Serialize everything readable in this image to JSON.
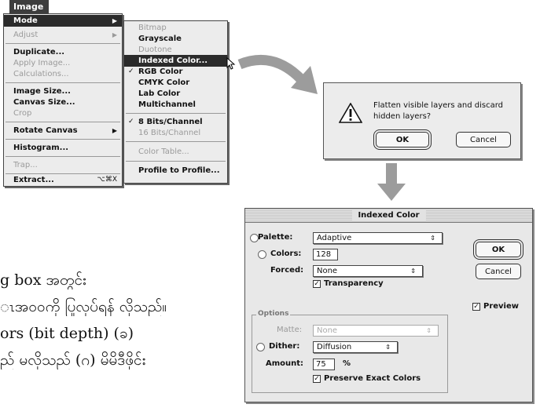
{
  "image_menu": {
    "title": "Image",
    "items": [
      {
        "label": "Mode",
        "arrow": "▶",
        "highlighted": true
      },
      {
        "label": "Adjust",
        "arrow": "▶",
        "disabled": true
      },
      {
        "label": "Duplicate..."
      },
      {
        "label": "Apply Image...",
        "disabled": true
      },
      {
        "label": "Calculations...",
        "disabled": true
      },
      {
        "label": "Image Size..."
      },
      {
        "label": "Canvas Size..."
      },
      {
        "label": "Crop",
        "disabled": true
      },
      {
        "label": "Rotate Canvas",
        "arrow": "▶"
      },
      {
        "label": "Histogram..."
      },
      {
        "label": "Trap...",
        "disabled": true
      },
      {
        "label": "Extract...",
        "shortcut": "⌥⌘X"
      }
    ]
  },
  "mode_submenu": {
    "items": [
      {
        "label": "Bitmap",
        "disabled": true
      },
      {
        "label": "Grayscale"
      },
      {
        "label": "Duotone",
        "disabled": true
      },
      {
        "label": "Indexed Color...",
        "highlighted": true
      },
      {
        "label": "RGB Color",
        "checked": true
      },
      {
        "label": "CMYK Color"
      },
      {
        "label": "Lab Color"
      },
      {
        "label": "Multichannel"
      },
      {
        "label": "8 Bits/Channel",
        "checked": true
      },
      {
        "label": "16 Bits/Channel",
        "disabled": true
      },
      {
        "label": "Color Table...",
        "disabled": true
      },
      {
        "label": "Profile to Profile..."
      }
    ],
    "check_glyph": "✓"
  },
  "flatten_dialog": {
    "message": "Flatten visible layers and discard hidden layers?",
    "ok_label": "OK",
    "cancel_label": "Cancel",
    "icon": "warning-icon"
  },
  "indexed_color_dialog": {
    "title": "Indexed Color",
    "palette_label": "Palette:",
    "palette_value": "Adaptive",
    "colors_label": "Colors:",
    "colors_value": "128",
    "forced_label": "Forced:",
    "forced_value": "None",
    "transparency_label": "Transparency",
    "transparency_checked": true,
    "options_group": "Options",
    "matte_label": "Matte:",
    "matte_value": "None",
    "dither_label": "Dither:",
    "dither_value": "Diffusion",
    "amount_label": "Amount:",
    "amount_value": "75",
    "amount_unit": "%",
    "preserve_label": "Preserve Exact Colors",
    "preserve_checked": true,
    "ok_label": "OK",
    "cancel_label": "Cancel",
    "preview_label": "Preview",
    "preview_checked": true,
    "popup_arrow": "⇕",
    "check_glyph": "✓"
  },
  "body_text": {
    "line1": "g box အတွင်း",
    "line2": "ၤအဝဝကို ပြုလုပ်ရန် လိုသည်။",
    "line3": "ors (bit depth)  (ခ)",
    "line4": "ည် မလိုသည် (ဂ) မိမိဒီဖိုင်း"
  },
  "colors": {
    "menu_bg": "#ececec",
    "highlight": "#2b2b2b",
    "arrow_gray": "#9c9c9c"
  }
}
